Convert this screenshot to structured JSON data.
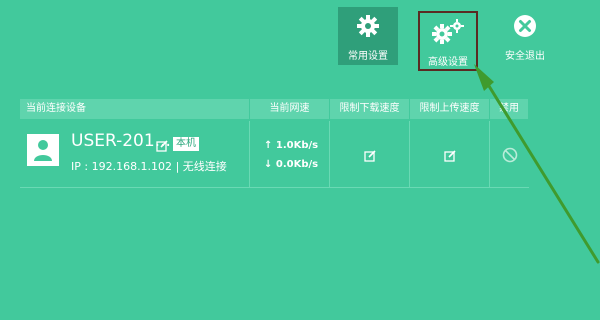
{
  "toolbar": {
    "common_label": "常用设置",
    "advanced_label": "高级设置",
    "exit_label": "安全退出"
  },
  "table": {
    "headers": {
      "device": "当前连接设备",
      "speed": "当前网速",
      "limit_down": "限制下载速度",
      "limit_up": "限制上传速度",
      "ban": "禁用"
    },
    "rows": [
      {
        "name": "USER-201...",
        "badge": "本机",
        "ip_label": "IP : 192.168.1.102",
        "separator": "|",
        "connection": "无线连接",
        "speed_up": "↑ 1.0Kb/s",
        "speed_down": "↓ 0.0Kb/s"
      }
    ]
  },
  "colors": {
    "background": "#42c99c",
    "header_bg": "#5fd4ad",
    "selected_btn_bg": "#2f9f7a",
    "highlight_border": "#5a2a22",
    "arrow": "#3f9b2e"
  },
  "icons": {
    "common": "gear-icon",
    "advanced": "gears-icon",
    "exit": "close-circle-icon",
    "avatar": "user-icon",
    "edit": "edit-icon",
    "ban": "ban-icon"
  }
}
